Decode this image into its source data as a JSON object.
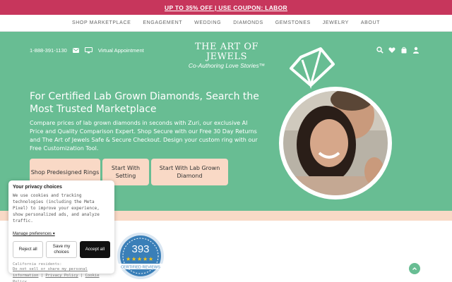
{
  "promo": {
    "text": "UP TO 35% OFF | USE COUPON: LABOR"
  },
  "nav": {
    "items": [
      {
        "label": "SHOP MARKETPLACE"
      },
      {
        "label": "ENGAGEMENT"
      },
      {
        "label": "WEDDING"
      },
      {
        "label": "DIAMONDS"
      },
      {
        "label": "GEMSTONES"
      },
      {
        "label": "JEWELRY"
      },
      {
        "label": "ABOUT"
      }
    ]
  },
  "utility": {
    "phone": "1-888-391-1130",
    "virtual_appointment": "Virtual Appointment"
  },
  "logo": {
    "main": "THE ART OF JEWELS",
    "sub": "Co-Authoring Love Stories™"
  },
  "hero": {
    "headline": "For Certified Lab Grown Diamonds, Search the Most Trusted Marketplace",
    "description": "Compare prices of lab grown diamonds in seconds with Zuri, our exclusive AI Price and Quality Comparison Expert. Shop Secure with our Free 30 Day Returns and The Art of Jewels Safe & Secure Checkout. Design your custom ring with our Free Customization Tool.",
    "cta1": "Shop Predesigned Rings",
    "cta2": "Start With Setting",
    "cta3": "Start With Lab Grown Diamond"
  },
  "cookie": {
    "title": "Your privacy choices",
    "body": "We use cookies and tracking technologies (including the Meta Pixel) to improve your experience, show personalized ads, and analyze traffic.",
    "manage": "Manage preferences ▾",
    "reject": "Reject all",
    "save": "Save my choices",
    "accept": "Accept all",
    "residents": "California residents:",
    "do_not_sell": "Do not sell or share my personal information",
    "privacy": "Privacy Policy",
    "cookie_policy": "Cookie Policy"
  },
  "badge": {
    "count": "393",
    "label": "CERTIFIED REVIEWS",
    "stars": 5
  },
  "colors": {
    "promo": "#c7365c",
    "hero": "#68bd93",
    "peach": "#f9d9c6",
    "badge": "#3a7fb8"
  },
  "icons": [
    "mail-icon",
    "monitor-icon",
    "search-icon",
    "heart-icon",
    "bag-icon",
    "user-icon",
    "chevron-up-icon",
    "ring-icon",
    "star-icon"
  ]
}
